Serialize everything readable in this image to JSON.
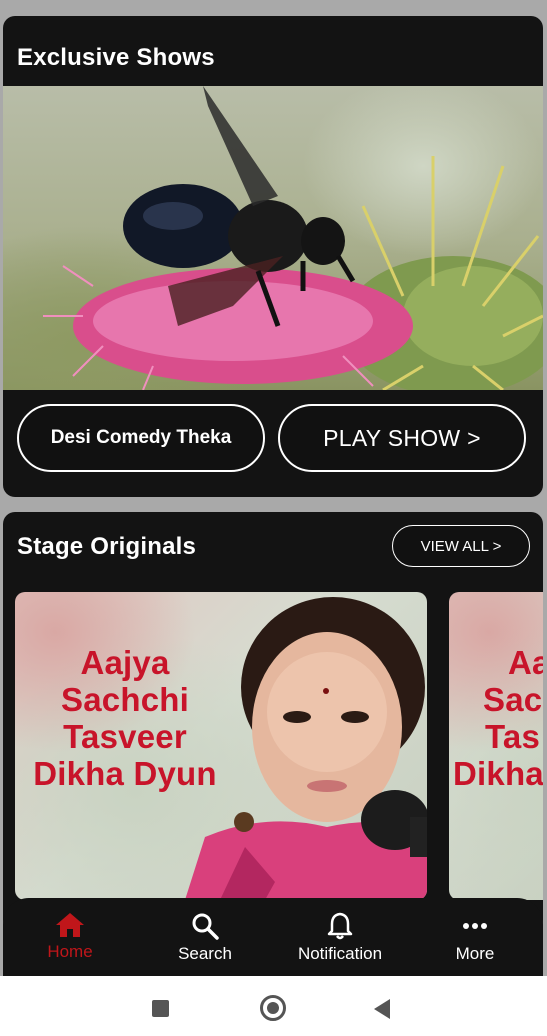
{
  "exclusive": {
    "title": "Exclusive Shows",
    "show_name": "Desi Comedy Theka",
    "play_label": "PLAY SHOW >"
  },
  "originals": {
    "title": "Stage Originals",
    "view_all_label": "VIEW ALL >",
    "items": [
      {
        "lines": [
          "Aajya",
          "Sachchi",
          "Tasveer",
          "Dikha Dyun"
        ]
      },
      {
        "lines": [
          "Aa",
          "Sac",
          "Tas",
          "Dikha"
        ]
      }
    ]
  },
  "nav": {
    "items": [
      {
        "label": "Home",
        "icon": "home-icon",
        "active": true
      },
      {
        "label": "Search",
        "icon": "search-icon",
        "active": false
      },
      {
        "label": "Notification",
        "icon": "bell-icon",
        "active": false
      },
      {
        "label": "More",
        "icon": "more-dots-icon",
        "active": false
      }
    ],
    "active_color": "#c0161a"
  },
  "system_bar": {
    "buttons": [
      "recents-icon",
      "home-circle-icon",
      "back-icon"
    ]
  },
  "colors": {
    "card_bg": "#131313",
    "page_bg": "#a9a9a9",
    "thumb_text": "#c8142a"
  }
}
